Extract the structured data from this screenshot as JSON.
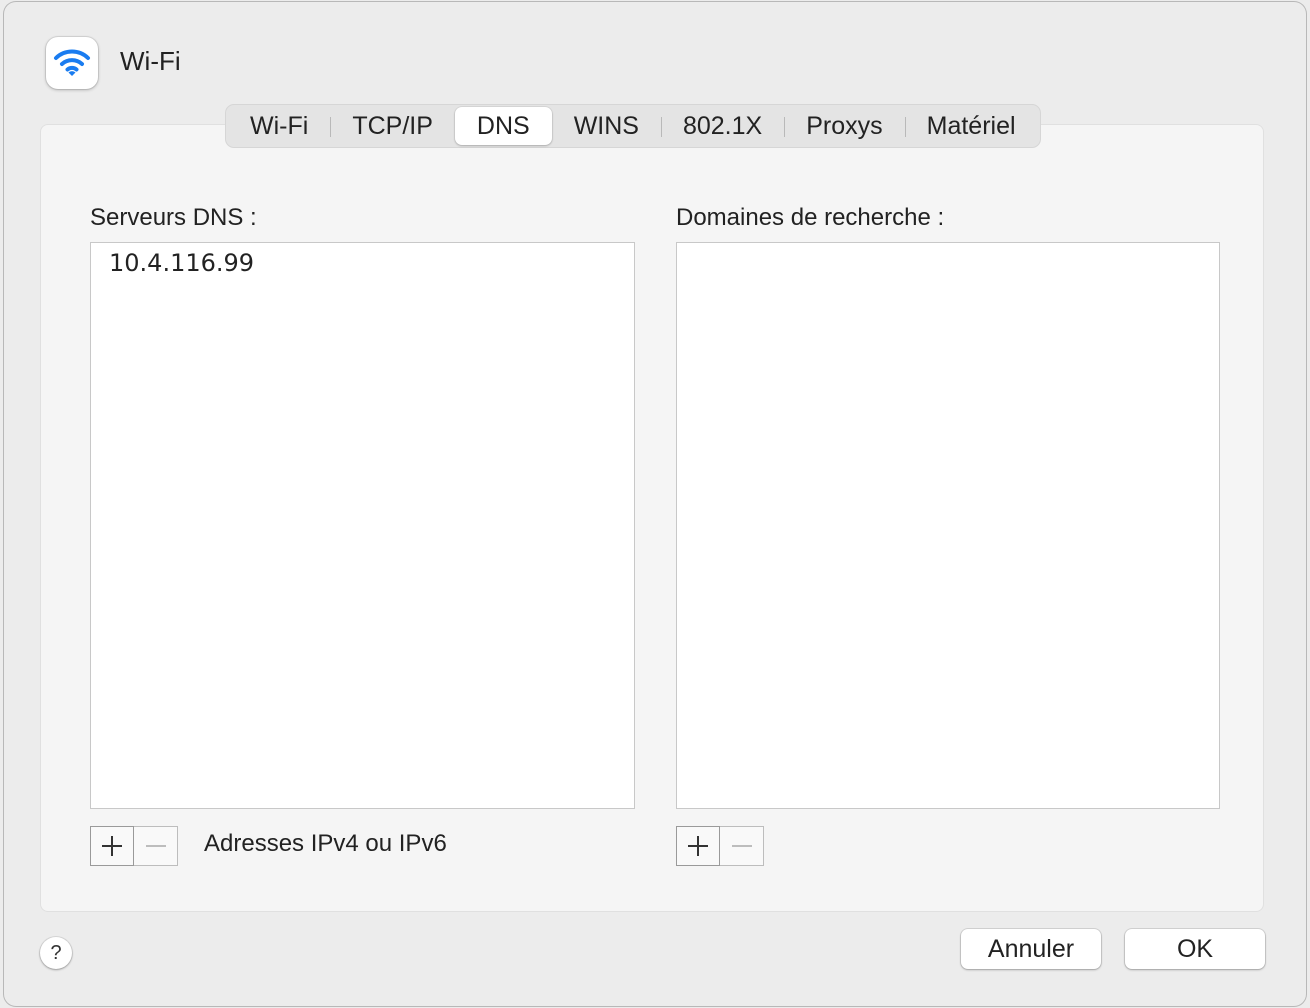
{
  "header": {
    "title": "Wi-Fi",
    "icon": "wifi-icon",
    "accent": "#1a7cf0"
  },
  "tabs": [
    {
      "label": "Wi-Fi",
      "active": false
    },
    {
      "label": "TCP/IP",
      "active": false
    },
    {
      "label": "DNS",
      "active": true
    },
    {
      "label": "WINS",
      "active": false
    },
    {
      "label": "802.1X",
      "active": false
    },
    {
      "label": "Proxys",
      "active": false
    },
    {
      "label": "Matériel",
      "active": false
    }
  ],
  "dns": {
    "label": "Serveurs DNS :",
    "servers": [
      "10.4.116.99"
    ],
    "hint": "Adresses IPv4 ou IPv6"
  },
  "search": {
    "label": "Domaines de recherche :",
    "domains": []
  },
  "controls": {
    "add_icon": "plus-icon",
    "remove_icon": "minus-icon"
  },
  "footer": {
    "help_label": "?",
    "cancel_label": "Annuler",
    "ok_label": "OK"
  }
}
